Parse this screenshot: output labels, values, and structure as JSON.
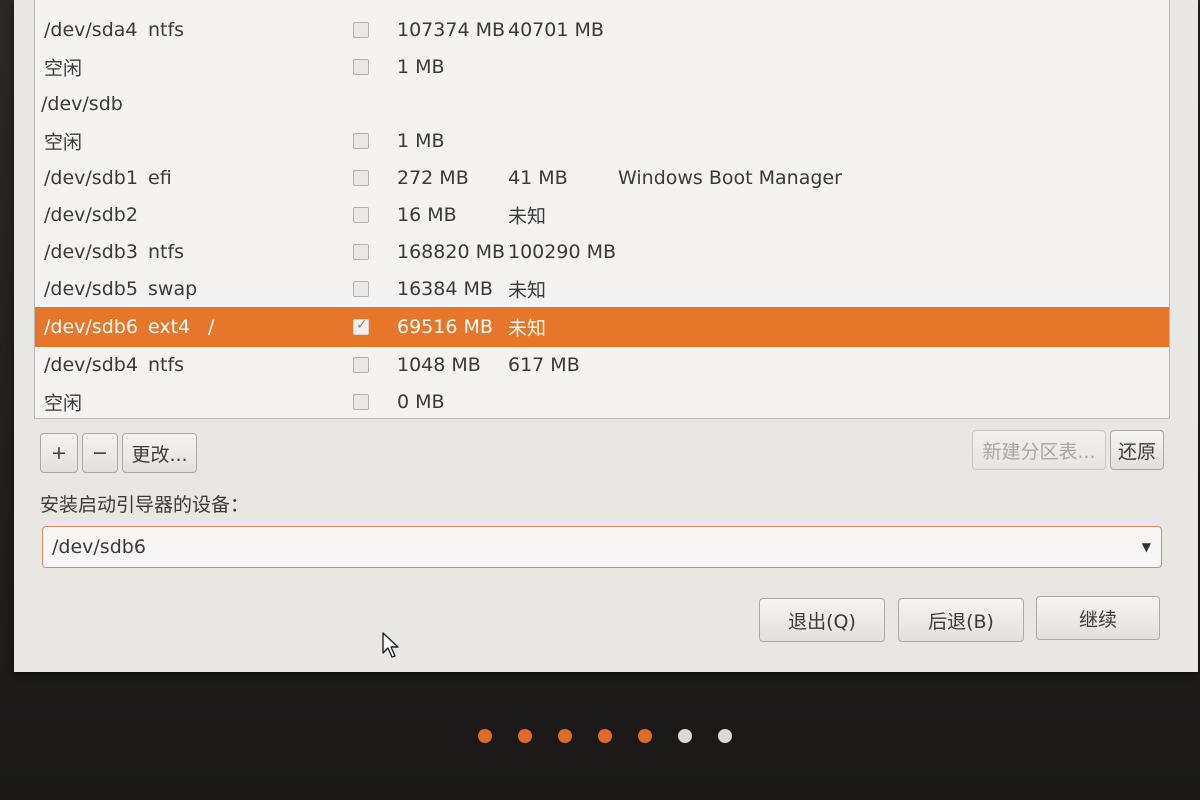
{
  "partitions": [
    {
      "device": "/dev/sda4",
      "type": "ntfs",
      "mount": "",
      "format": false,
      "size": "107374 MB",
      "used": "40701 MB",
      "system": ""
    },
    {
      "device": "空闲",
      "type": "",
      "mount": "",
      "format": false,
      "size": "1 MB",
      "used": "",
      "system": ""
    },
    {
      "device": "/dev/sdb",
      "type": "",
      "mount": "",
      "format": null,
      "size": "",
      "used": "",
      "system": ""
    },
    {
      "device": "空闲",
      "type": "",
      "mount": "",
      "format": false,
      "size": "1 MB",
      "used": "",
      "system": ""
    },
    {
      "device": "/dev/sdb1",
      "type": "efi",
      "mount": "",
      "format": false,
      "size": "272 MB",
      "used": "41 MB",
      "system": "Windows Boot Manager"
    },
    {
      "device": "/dev/sdb2",
      "type": "",
      "mount": "",
      "format": false,
      "size": "16 MB",
      "used": "未知",
      "system": ""
    },
    {
      "device": "/dev/sdb3",
      "type": "ntfs",
      "mount": "",
      "format": false,
      "size": "168820 MB",
      "used": "100290 MB",
      "system": ""
    },
    {
      "device": "/dev/sdb5",
      "type": "swap",
      "mount": "",
      "format": false,
      "size": "16384 MB",
      "used": "未知",
      "system": ""
    },
    {
      "device": "/dev/sdb6",
      "type": "ext4",
      "mount": "/",
      "format": true,
      "size": "69516 MB",
      "used": "未知",
      "system": "",
      "selected": true
    },
    {
      "device": "/dev/sdb4",
      "type": "ntfs",
      "mount": "",
      "format": false,
      "size": "1048 MB",
      "used": "617 MB",
      "system": ""
    },
    {
      "device": "空闲",
      "type": "",
      "mount": "",
      "format": false,
      "size": "0 MB",
      "used": "",
      "system": ""
    }
  ],
  "toolbar": {
    "add_label": "+",
    "remove_label": "−",
    "change_label": "更改...",
    "new_table_label": "新建分区表...",
    "revert_label": "还原"
  },
  "bootloader": {
    "label": "安装启动引导器的设备：",
    "value": "/dev/sdb6"
  },
  "footer": {
    "quit_label": "退出(Q)",
    "back_label": "后退(B)",
    "continue_label": "继续"
  },
  "progress_dots": {
    "total": 7,
    "completed": 5
  },
  "colors": {
    "accent": "#e5762a",
    "dot_done": "#e06b26",
    "dot_todo": "#dcdad6"
  }
}
